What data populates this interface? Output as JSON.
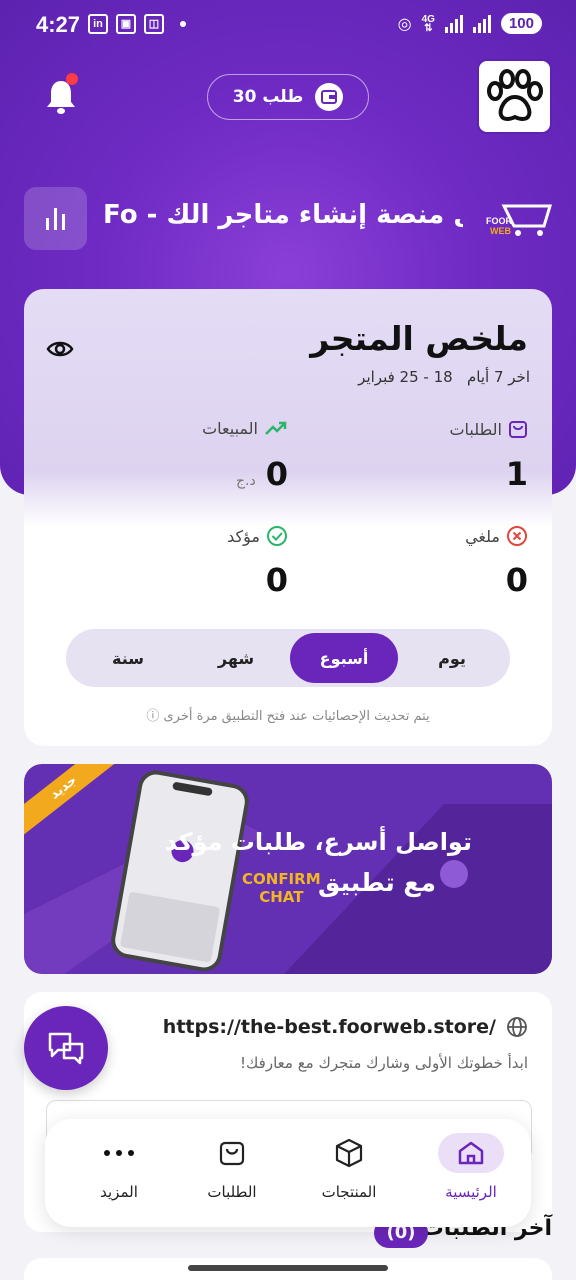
{
  "status_bar": {
    "time": "4:27",
    "battery": "100",
    "network": "4G"
  },
  "header": {
    "orders_pill": "30 طلب",
    "store_name": "Fo - أفضل منصة إنشاء متاجر الك",
    "logo_text": "FOOR WEB",
    "has_notification": true
  },
  "summary": {
    "title": "ملخص المتجر",
    "range_prefix": "اخر 7 أيام",
    "range_dates": "18 - 25 فبراير",
    "orders_label": "الطلبات",
    "orders_value": "1",
    "sales_label": "المبيعات",
    "sales_value": "0",
    "currency": "د.ج",
    "cancelled_label": "ملغي",
    "cancelled_value": "0",
    "confirmed_label": "مؤكد",
    "confirmed_value": "0",
    "periods": [
      "يوم",
      "أسبوع",
      "شهر",
      "سنة"
    ],
    "active_period": "أسبوع",
    "note": "يتم تحديث الإحصائيات عند فتح التطبيق مرة أخرى"
  },
  "banner": {
    "ribbon": "جديد",
    "line1": "تواصل أسرع، طلبات مؤكد",
    "line2": "مع تطبيق",
    "brand_line1": "CONFIRM",
    "brand_line2": "CHAT"
  },
  "share": {
    "url": "https://the-best.foorweb.store/",
    "subtitle": "ابدأ خطوتك الأولى وشارك متجرك مع معارفك!"
  },
  "latest": {
    "title": "آخر الطلبات",
    "count": "(0)"
  },
  "nav": {
    "home": "الرئيسية",
    "products": "المنتجات",
    "orders": "الطلبات",
    "more": "المزيد"
  },
  "colors": {
    "primary": "#6a26ba",
    "header_bg": "#6f2bc4",
    "notification_dot": "#ff3b48",
    "sales_icon": "#2bb56a",
    "cancel_icon": "#e3453f",
    "ribbon": "#f2a91d"
  }
}
